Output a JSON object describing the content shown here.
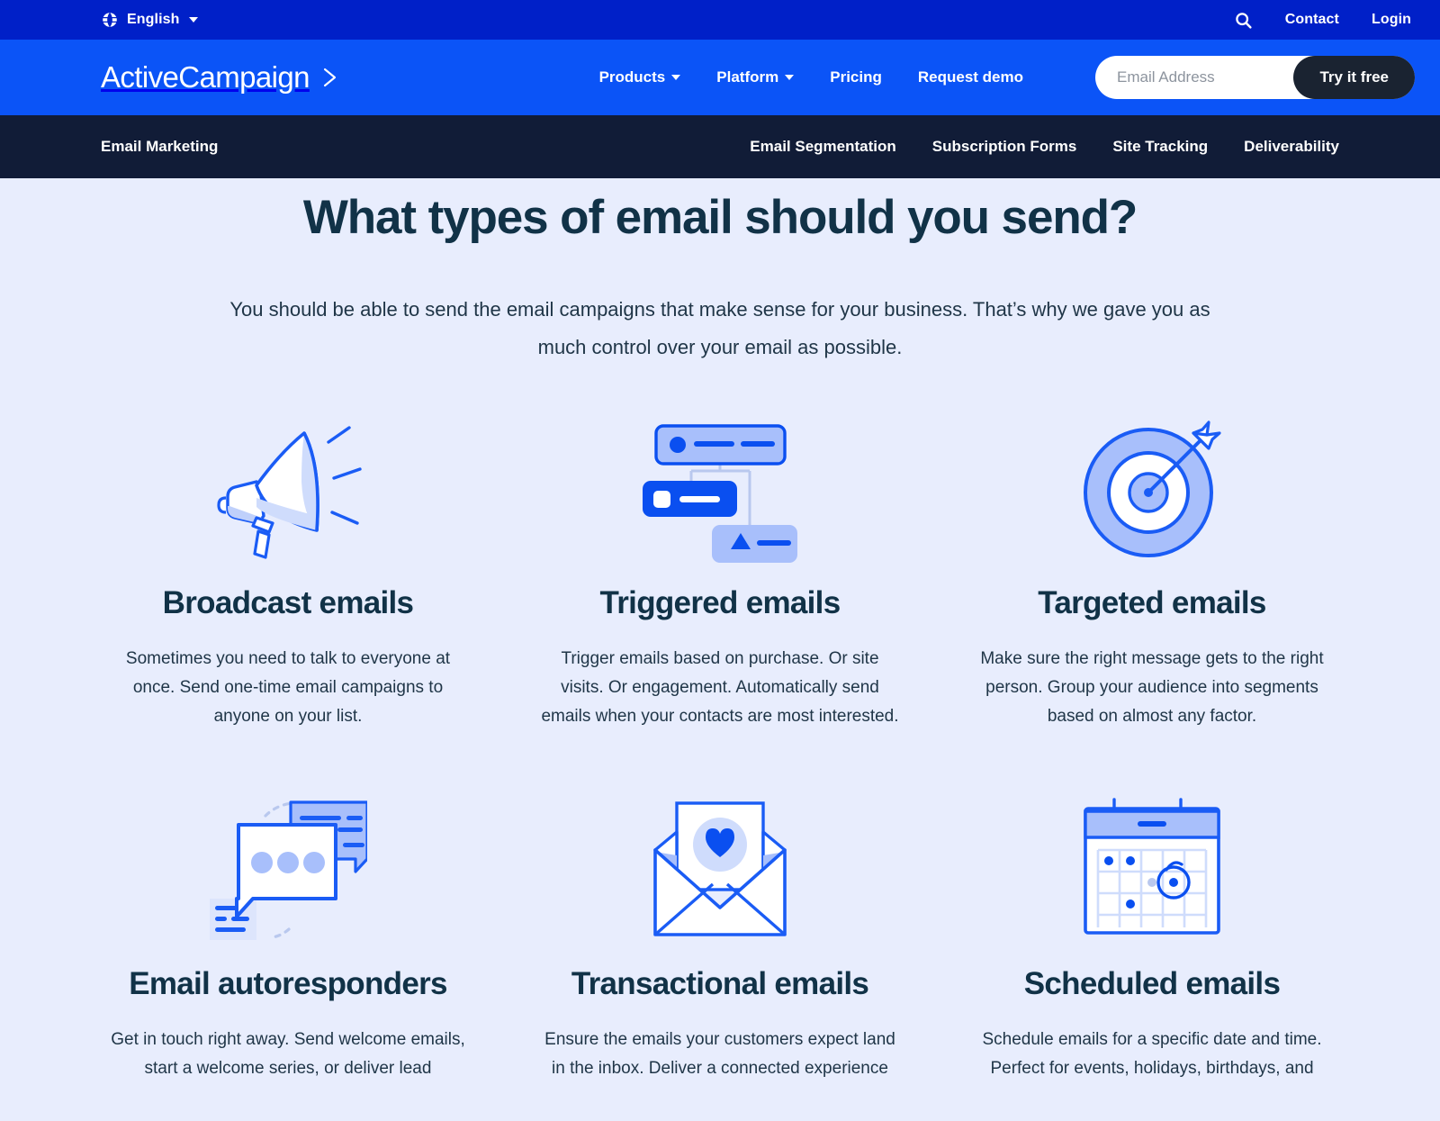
{
  "utility_bar": {
    "globe_icon": "globe-icon",
    "language": "English",
    "search_icon": "search-icon",
    "contact": "Contact",
    "login": "Login"
  },
  "main_nav": {
    "brand": "ActiveCampaign",
    "brand_chevron_icon": "chevron-right-icon",
    "links": [
      {
        "label": "Products",
        "has_caret": true
      },
      {
        "label": "Platform",
        "has_caret": true
      },
      {
        "label": "Pricing",
        "has_caret": false
      },
      {
        "label": "Request demo",
        "has_caret": false
      }
    ],
    "email_placeholder": "Email Address",
    "email_value": "",
    "cta_label": "Try it free"
  },
  "sub_nav": {
    "title": "Email Marketing",
    "links": [
      "Email Segmentation",
      "Subscription Forms",
      "Site Tracking",
      "Deliverability"
    ]
  },
  "hero": {
    "title": "What types of email should you send?",
    "subtitle": "You should be able to send the email campaigns that make sense for your business. That’s why we gave you as much control over your email as possible."
  },
  "cards": [
    {
      "icon": "megaphone-icon",
      "title": "Broadcast emails",
      "desc": "Sometimes you need to talk to everyone at once. Send one-time email campaigns to anyone on your list."
    },
    {
      "icon": "automation-workflow-icon",
      "title": "Triggered emails",
      "desc": "Trigger emails based on purchase. Or site visits. Or engagement. Automatically send emails when your contacts are most interested."
    },
    {
      "icon": "target-bullseye-icon",
      "title": "Targeted emails",
      "desc": "Make sure the right message gets to the right person. Group your audience into segments based on almost any factor."
    },
    {
      "icon": "chat-bubbles-icon",
      "title": "Email autoresponders",
      "desc": "Get in touch right away. Send welcome emails, start a welcome series, or deliver lead"
    },
    {
      "icon": "envelope-heart-icon",
      "title": "Transactional emails",
      "desc": "Ensure the emails your customers expect land in the inbox. Deliver a connected experience"
    },
    {
      "icon": "calendar-icon",
      "title": "Scheduled emails",
      "desc": "Schedule emails for a specific date and time. Perfect for events, holidays, birthdays, and"
    }
  ],
  "colors": {
    "utility_bar_bg": "#0020c8",
    "main_nav_bg": "#0b54f7",
    "sub_nav_bg": "#111c37",
    "page_bg": "#e8edfd",
    "heading": "#113247",
    "icon_stroke": "#1a5cf5",
    "icon_fill_light": "#a8bffb",
    "cta_bg": "#1a2331"
  }
}
